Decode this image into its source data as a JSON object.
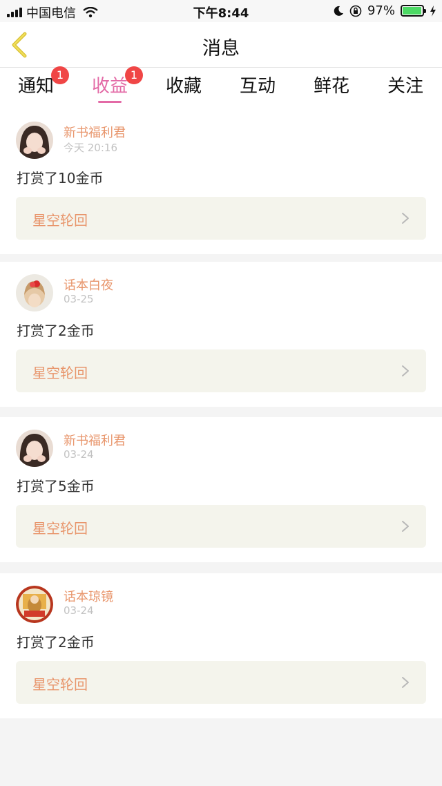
{
  "status_bar": {
    "carrier": "中国电信",
    "time": "下午8:44",
    "battery": "97%",
    "battery_level": 0.97,
    "battery_color": "#4cd964"
  },
  "header": {
    "back_icon": "chevron-left-icon",
    "title": "消息"
  },
  "tabs": [
    {
      "label": "通知",
      "badge": "1",
      "active": false
    },
    {
      "label": "收益",
      "badge": "1",
      "active": true
    },
    {
      "label": "收藏",
      "badge": "",
      "active": false
    },
    {
      "label": "互动",
      "badge": "",
      "active": false
    },
    {
      "label": "鲜花",
      "badge": "",
      "active": false
    },
    {
      "label": "关注",
      "badge": "",
      "active": false
    }
  ],
  "colors": {
    "accent": "#e36aa6",
    "badge": "#f04646",
    "name": "#e8956b",
    "book_bg": "#f4f4ec"
  },
  "messages": [
    {
      "name": "新书福利君",
      "time": "今天 20:16",
      "text": "打赏了10金币",
      "book": "星空轮回"
    },
    {
      "name": "话本白夜",
      "time": "03-25",
      "text": "打赏了2金币",
      "book": "星空轮回"
    },
    {
      "name": "新书福利君",
      "time": "03-24",
      "text": "打赏了5金币",
      "book": "星空轮回"
    },
    {
      "name": "话本琼镜",
      "time": "03-24",
      "text": "打赏了2金币",
      "book": "星空轮回"
    }
  ]
}
